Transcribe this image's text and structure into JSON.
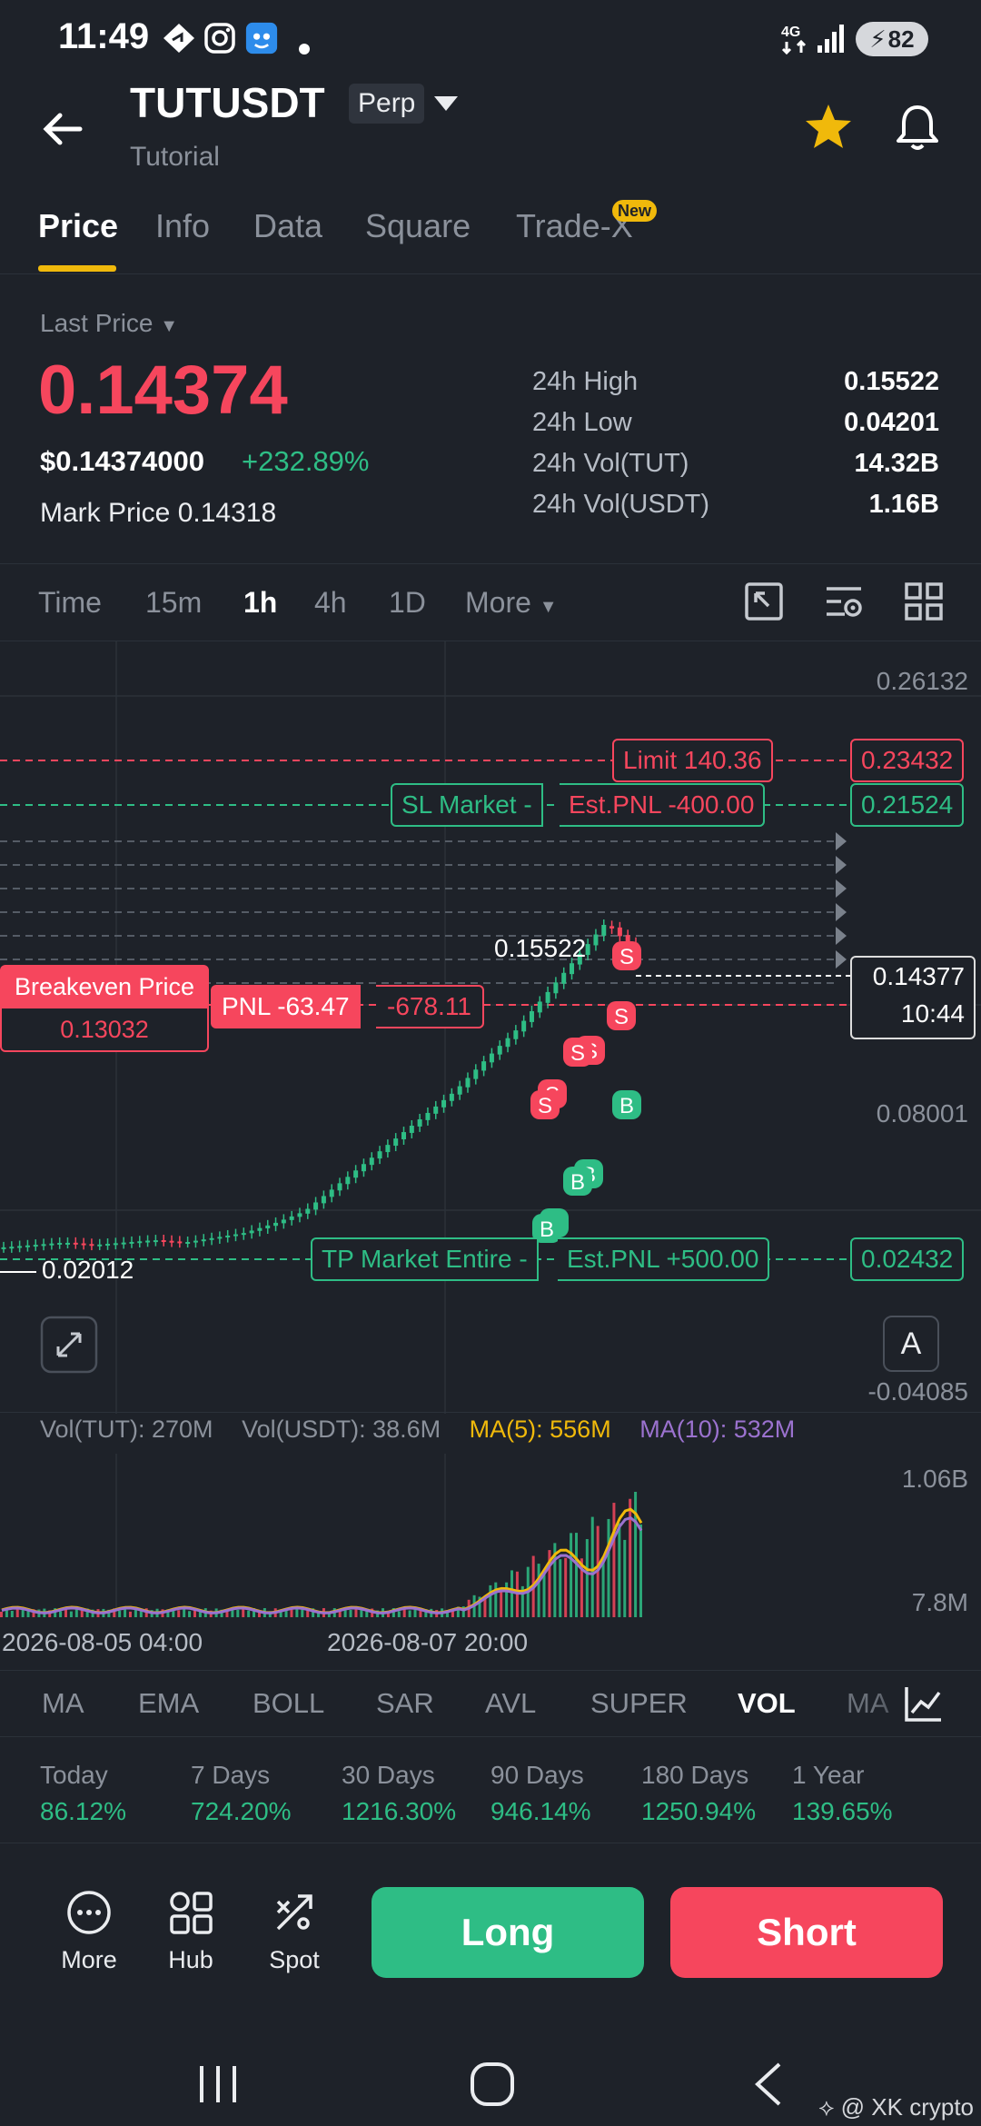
{
  "status_bar": {
    "time": "11:49",
    "battery": "82",
    "network": "4G"
  },
  "header": {
    "pair": "TUTUSDT",
    "badge": "Perp",
    "subtitle": "Tutorial"
  },
  "tabs": [
    {
      "label": "Price",
      "active": true
    },
    {
      "label": "Info"
    },
    {
      "label": "Data"
    },
    {
      "label": "Square"
    },
    {
      "label": "Trade-X",
      "badge": "New"
    }
  ],
  "price": {
    "last_price_label": "Last Price",
    "last_price": "0.14374",
    "usd_price": "$0.14374000",
    "change_pct": "+232.89%",
    "mark_price_label": "Mark Price",
    "mark_price": "0.14318"
  },
  "stats": [
    {
      "label": "24h High",
      "value": "0.15522"
    },
    {
      "label": "24h Low",
      "value": "0.04201"
    },
    {
      "label": "24h Vol(TUT)",
      "value": "14.32B"
    },
    {
      "label": "24h Vol(USDT)",
      "value": "1.16B"
    }
  ],
  "intervals": [
    {
      "label": "Time"
    },
    {
      "label": "15m"
    },
    {
      "label": "1h",
      "active": true
    },
    {
      "label": "4h"
    },
    {
      "label": "1D"
    },
    {
      "label": "More"
    }
  ],
  "chart": {
    "axis_labels": [
      "0.26132",
      "0.08001",
      "-0.04085"
    ],
    "limit": {
      "label": "Limit 140.36",
      "price": "0.23432"
    },
    "sl": {
      "label": "SL Market -",
      "pnl": "Est.PNL -400.00",
      "price": "0.21524"
    },
    "high_marker": "0.15522",
    "current": {
      "price": "0.14377",
      "countdown": "10:44"
    },
    "breakeven": {
      "label": "Breakeven Price",
      "price": "0.13032"
    },
    "position": {
      "pnl": "PNL -63.47",
      "value": "-678.11"
    },
    "low_marker": "0.02012",
    "tp": {
      "label": "TP Market Entire -",
      "pnl": "Est.PNL +500.00",
      "price": "0.02432"
    },
    "scale_button": "A",
    "colors": {
      "up": "#2ebd85",
      "down": "#f6465d",
      "accent": "#f0b90b",
      "ma10": "#9b72cf"
    }
  },
  "chart_data": {
    "type": "line",
    "x": [
      "2026-08-05 04:00",
      "2026-08-07 20:00"
    ],
    "price_close": [
      0.02,
      0.021,
      0.022,
      0.021,
      0.022,
      0.023,
      0.022,
      0.024,
      0.026,
      0.03,
      0.035,
      0.045,
      0.055,
      0.065,
      0.075,
      0.085,
      0.098,
      0.11,
      0.125,
      0.14,
      0.155,
      0.143
    ],
    "volume_axis": [
      "1.06B",
      "7.8M"
    ],
    "ylim": [
      -0.04085,
      0.26132
    ]
  },
  "volume": {
    "vol_tut": "Vol(TUT): 270M",
    "vol_usdt": "Vol(USDT): 38.6M",
    "ma5": "MA(5): 556M",
    "ma10": "MA(10): 532M",
    "axis_top": "1.06B",
    "axis_bottom": "7.8M",
    "date_left": "2026-08-05 04:00",
    "date_right": "2026-08-07 20:00"
  },
  "indicators": [
    {
      "label": "MA"
    },
    {
      "label": "EMA"
    },
    {
      "label": "BOLL"
    },
    {
      "label": "SAR"
    },
    {
      "label": "AVL"
    },
    {
      "label": "SUPER"
    },
    {
      "label": "VOL",
      "active": true
    },
    {
      "label": "MA"
    }
  ],
  "performance": [
    {
      "label": "Today",
      "value": "86.12%"
    },
    {
      "label": "7 Days",
      "value": "724.20%"
    },
    {
      "label": "30 Days",
      "value": "1216.30%"
    },
    {
      "label": "90 Days",
      "value": "946.14%"
    },
    {
      "label": "180 Days",
      "value": "1250.94%"
    },
    {
      "label": "1 Year",
      "value": "139.65%"
    }
  ],
  "actions": {
    "more": "More",
    "hub": "Hub",
    "spot": "Spot",
    "long": "Long",
    "short": "Short"
  },
  "watermark": "@ XK crypto"
}
